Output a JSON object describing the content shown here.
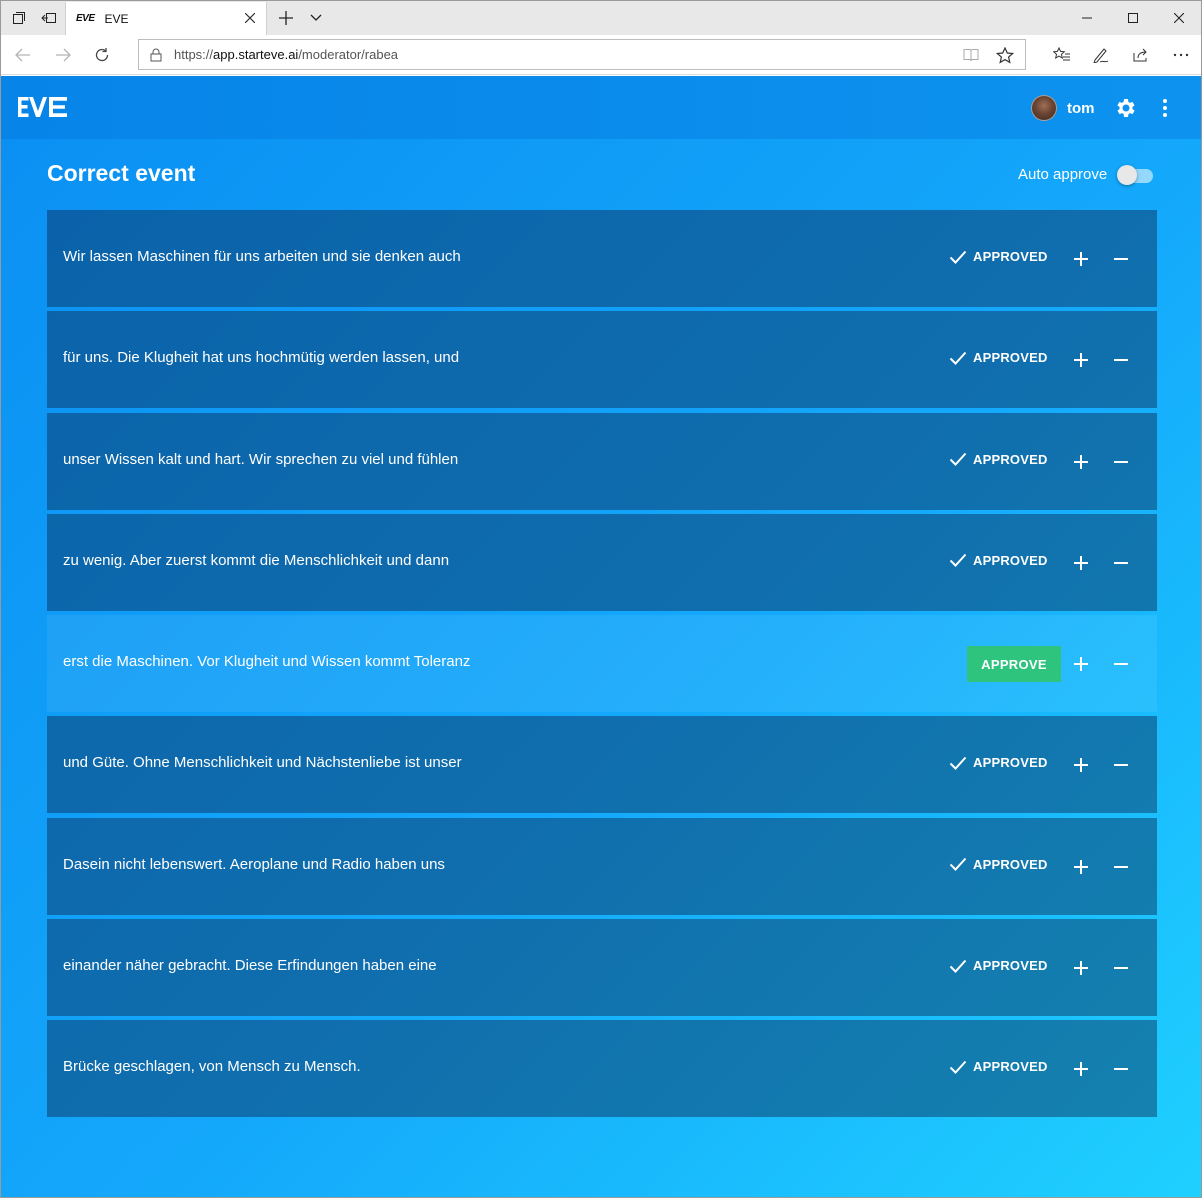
{
  "browser": {
    "tab_title": "EVE",
    "tab_logo": "EVE",
    "url_prefix": "https://",
    "url_host": "app.starteve.ai",
    "url_path": "/moderator/rabea"
  },
  "app": {
    "user_name": "tom",
    "page_title": "Correct event",
    "auto_approve_label": "Auto approve",
    "auto_approve_on": false
  },
  "labels": {
    "approved": "APPROVED",
    "approve": "APPROVE"
  },
  "segments": [
    {
      "text": "Wir lassen Maschinen für uns arbeiten und sie denken auch",
      "status": "approved"
    },
    {
      "text": "für uns. Die Klugheit hat uns hochmütig werden lassen, und",
      "status": "approved"
    },
    {
      "text": "unser Wissen kalt und hart. Wir sprechen zu viel und fühlen",
      "status": "approved"
    },
    {
      "text": "zu wenig. Aber zuerst kommt die Menschlichkeit und dann",
      "status": "approved"
    },
    {
      "text": "erst die Maschinen. Vor Klugheit und Wissen kommt Toleranz",
      "status": "pending"
    },
    {
      "text": "und Güte. Ohne Menschlichkeit und Nächstenliebe ist unser",
      "status": "approved"
    },
    {
      "text": "Dasein nicht lebenswert. Aeroplane und Radio haben uns",
      "status": "approved"
    },
    {
      "text": "einander näher gebracht. Diese Erfindungen haben eine",
      "status": "approved"
    },
    {
      "text": "Brücke geschlagen, von Mensch zu Mensch.",
      "status": "approved"
    }
  ],
  "colors": {
    "approve_button": "#2ec47e",
    "app_gradient_start": "#0a8ff2",
    "app_gradient_end": "#1fd0ff"
  }
}
